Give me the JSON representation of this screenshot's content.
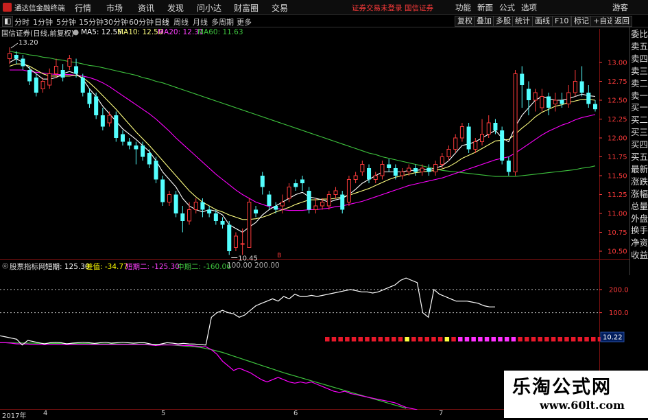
{
  "menubar": {
    "app_title": "通达信金融终端",
    "menus": [
      "行情",
      "市场",
      "资讯",
      "发现",
      "问小达",
      "财富圈",
      "交易"
    ],
    "login_warning": "证券交易未登录",
    "broker": "国信证券",
    "right_buttons": [
      "功能",
      "新面",
      "公式",
      "选项"
    ],
    "guest": "游客"
  },
  "periods": [
    "分时",
    "1分钟",
    "5分钟",
    "15分钟",
    "30分钟",
    "60分钟",
    "日线",
    "周线",
    "月线",
    "多周期",
    "更多"
  ],
  "active_period": "日线",
  "toolbar_right": [
    "复权",
    "叠加",
    "多股",
    "统计",
    "画线",
    "F10",
    "标记",
    "+自选",
    "返回"
  ],
  "info": {
    "title": "国信证券(日线,前复权)",
    "ma5": "MA5: 12.55",
    "ma10": "MA10: 12.50",
    "ma20": "MA20: 12.31",
    "ma60": "MA60: 11.63"
  },
  "colors": {
    "up": "#ff3b3b",
    "up_fill": "#000000",
    "down": "#54ffff",
    "ma5": "#ffffff",
    "ma10": "#ffff80",
    "ma20": "#ff00ff",
    "ma60": "#3ec43e",
    "grid": "#7a1010",
    "yellow": "#ffff00"
  },
  "right_panel": [
    "委比",
    "卖五",
    "卖四",
    "卖三",
    "卖二",
    "卖一",
    "买一",
    "买二",
    "买三",
    "买四",
    "买五",
    "最新",
    "涨跌",
    "涨幅",
    "总量",
    "外盘",
    "换手",
    "净资",
    "收益"
  ],
  "indicator": {
    "name": "股票指标网",
    "short_label": "短期: 125.30",
    "diff_label": "差值: -34.77",
    "short2_label": "短期二: -125.30",
    "mid2_label": "中期二: -160.06",
    "level100": "100.00",
    "level200": "200.00"
  },
  "dates": [
    "2017年",
    "4",
    "5",
    "6",
    "7"
  ],
  "watermark": {
    "cn": "乐淘公式网",
    "url": "www.60lt.com"
  },
  "chart_data": {
    "type": "candlestick",
    "price_axis": {
      "ticks": [
        13.0,
        12.75,
        12.5,
        12.25,
        12.0,
        11.75,
        11.5,
        11.25,
        11.0,
        10.75,
        10.5
      ],
      "ylim": [
        10.4,
        13.3
      ]
    },
    "annotations": {
      "high": "13.20",
      "low": "10.45",
      "marker": "B",
      "current_value": "10.22"
    },
    "candles": [
      {
        "o": 13.05,
        "c": 13.12,
        "h": 13.2,
        "l": 12.98
      },
      {
        "o": 13.1,
        "c": 13.05,
        "h": 13.15,
        "l": 12.98
      },
      {
        "o": 13.05,
        "c": 12.95,
        "h": 13.1,
        "l": 12.9
      },
      {
        "o": 12.9,
        "c": 12.75,
        "h": 12.95,
        "l": 12.7
      },
      {
        "o": 12.8,
        "c": 12.6,
        "h": 12.85,
        "l": 12.55
      },
      {
        "o": 12.65,
        "c": 12.75,
        "h": 12.8,
        "l": 12.6
      },
      {
        "o": 12.7,
        "c": 12.85,
        "h": 12.92,
        "l": 12.65
      },
      {
        "o": 12.85,
        "c": 12.95,
        "h": 13.05,
        "l": 12.8
      },
      {
        "o": 12.9,
        "c": 12.8,
        "h": 12.98,
        "l": 12.75
      },
      {
        "o": 12.95,
        "c": 13.05,
        "h": 13.1,
        "l": 12.9
      },
      {
        "o": 12.95,
        "c": 12.85,
        "h": 13.05,
        "l": 12.8
      },
      {
        "o": 12.8,
        "c": 12.6,
        "h": 12.85,
        "l": 12.55
      },
      {
        "o": 12.6,
        "c": 12.45,
        "h": 12.65,
        "l": 12.4
      },
      {
        "o": 12.55,
        "c": 12.3,
        "h": 12.6,
        "l": 12.25
      },
      {
        "o": 12.3,
        "c": 12.15,
        "h": 12.4,
        "l": 12.1
      },
      {
        "o": 12.2,
        "c": 12.3,
        "h": 12.35,
        "l": 12.15
      },
      {
        "o": 12.3,
        "c": 12.0,
        "h": 12.35,
        "l": 11.95
      },
      {
        "o": 12.05,
        "c": 11.95,
        "h": 12.1,
        "l": 11.9
      },
      {
        "o": 11.95,
        "c": 11.9,
        "h": 12.0,
        "l": 11.85
      },
      {
        "o": 11.9,
        "c": 11.85,
        "h": 11.95,
        "l": 11.65
      },
      {
        "o": 11.9,
        "c": 11.75,
        "h": 11.95,
        "l": 11.7
      },
      {
        "o": 11.8,
        "c": 11.65,
        "h": 11.85,
        "l": 11.6
      },
      {
        "o": 11.7,
        "c": 11.45,
        "h": 11.75,
        "l": 11.4
      },
      {
        "o": 11.45,
        "c": 11.15,
        "h": 11.5,
        "l": 11.1
      },
      {
        "o": 11.15,
        "c": 11.25,
        "h": 11.3,
        "l": 11.1
      },
      {
        "o": 11.25,
        "c": 11.0,
        "h": 11.3,
        "l": 10.95
      },
      {
        "o": 11.0,
        "c": 10.9,
        "h": 11.1,
        "l": 10.75
      },
      {
        "o": 10.9,
        "c": 11.05,
        "h": 11.15,
        "l": 10.85
      },
      {
        "o": 11.05,
        "c": 11.15,
        "h": 11.2,
        "l": 11.0
      },
      {
        "o": 11.15,
        "c": 11.05,
        "h": 11.2,
        "l": 10.95
      },
      {
        "o": 11.05,
        "c": 11.0,
        "h": 11.1,
        "l": 10.95
      },
      {
        "o": 11.0,
        "c": 10.9,
        "h": 11.05,
        "l": 10.85
      },
      {
        "o": 10.9,
        "c": 10.85,
        "h": 10.95,
        "l": 10.8
      },
      {
        "o": 10.85,
        "c": 10.5,
        "h": 10.9,
        "l": 10.45
      },
      {
        "o": 10.55,
        "c": 10.7,
        "h": 10.75,
        "l": 10.5
      },
      {
        "o": 10.6,
        "c": 10.6,
        "h": 10.8,
        "l": 10.45
      },
      {
        "o": 10.55,
        "c": 11.15,
        "h": 11.2,
        "l": 10.55
      },
      {
        "o": 11.05,
        "c": 11.0,
        "h": 11.1,
        "l": 10.95
      },
      {
        "o": 11.5,
        "c": 11.35,
        "h": 11.55,
        "l": 11.25
      },
      {
        "o": 11.25,
        "c": 11.1,
        "h": 11.3,
        "l": 11.05
      },
      {
        "o": 11.1,
        "c": 11.05,
        "h": 11.15,
        "l": 11.0
      },
      {
        "o": 11.1,
        "c": 11.15,
        "h": 11.25,
        "l": 11.0
      },
      {
        "o": 11.2,
        "c": 11.35,
        "h": 11.4,
        "l": 11.15
      },
      {
        "o": 11.4,
        "c": 11.35,
        "h": 11.45,
        "l": 11.3
      },
      {
        "o": 11.45,
        "c": 11.4,
        "h": 11.5,
        "l": 11.3
      },
      {
        "o": 11.3,
        "c": 11.05,
        "h": 11.35,
        "l": 11.0
      },
      {
        "o": 11.05,
        "c": 11.1,
        "h": 11.2,
        "l": 11.0
      },
      {
        "o": 11.1,
        "c": 11.15,
        "h": 11.2,
        "l": 11.05
      },
      {
        "o": 11.1,
        "c": 11.25,
        "h": 11.3,
        "l": 11.05
      },
      {
        "o": 11.25,
        "c": 11.3,
        "h": 11.35,
        "l": 11.2
      },
      {
        "o": 11.25,
        "c": 11.05,
        "h": 11.3,
        "l": 11.0
      },
      {
        "o": 11.15,
        "c": 11.45,
        "h": 11.5,
        "l": 11.1
      },
      {
        "o": 11.45,
        "c": 11.5,
        "h": 11.55,
        "l": 11.4
      },
      {
        "o": 11.55,
        "c": 11.65,
        "h": 11.7,
        "l": 11.5
      },
      {
        "o": 11.6,
        "c": 11.45,
        "h": 11.65,
        "l": 11.4
      },
      {
        "o": 11.45,
        "c": 11.5,
        "h": 11.55,
        "l": 11.4
      },
      {
        "o": 11.5,
        "c": 11.65,
        "h": 11.7,
        "l": 11.45
      },
      {
        "o": 11.65,
        "c": 11.6,
        "h": 11.72,
        "l": 11.55
      },
      {
        "o": 11.6,
        "c": 11.5,
        "h": 11.65,
        "l": 11.45
      },
      {
        "o": 11.5,
        "c": 11.55,
        "h": 11.6,
        "l": 11.45
      },
      {
        "o": 11.55,
        "c": 11.6,
        "h": 11.65,
        "l": 11.5
      },
      {
        "o": 11.6,
        "c": 11.55,
        "h": 11.65,
        "l": 11.5
      },
      {
        "o": 11.55,
        "c": 11.6,
        "h": 11.65,
        "l": 11.5
      },
      {
        "o": 11.6,
        "c": 11.55,
        "h": 11.65,
        "l": 11.5
      },
      {
        "o": 11.55,
        "c": 11.65,
        "h": 11.7,
        "l": 11.5
      },
      {
        "o": 11.65,
        "c": 11.75,
        "h": 11.8,
        "l": 11.6
      },
      {
        "o": 11.75,
        "c": 11.85,
        "h": 11.9,
        "l": 11.7
      },
      {
        "o": 11.85,
        "c": 12.0,
        "h": 12.05,
        "l": 11.8
      },
      {
        "o": 12.0,
        "c": 12.15,
        "h": 12.2,
        "l": 11.95
      },
      {
        "o": 12.15,
        "c": 11.85,
        "h": 12.2,
        "l": 11.8
      },
      {
        "o": 11.85,
        "c": 11.95,
        "h": 12.0,
        "l": 11.8
      },
      {
        "o": 11.95,
        "c": 12.05,
        "h": 12.25,
        "l": 11.9
      },
      {
        "o": 12.05,
        "c": 12.2,
        "h": 12.3,
        "l": 12.0
      },
      {
        "o": 12.2,
        "c": 12.1,
        "h": 12.25,
        "l": 12.05
      },
      {
        "o": 12.1,
        "c": 11.7,
        "h": 12.15,
        "l": 11.65
      },
      {
        "o": 11.7,
        "c": 11.55,
        "h": 11.75,
        "l": 11.5
      },
      {
        "o": 11.55,
        "c": 12.85,
        "h": 12.9,
        "l": 11.5
      },
      {
        "o": 12.85,
        "c": 12.7,
        "h": 12.95,
        "l": 12.4
      },
      {
        "o": 12.65,
        "c": 12.5,
        "h": 12.75,
        "l": 12.3
      },
      {
        "o": 12.5,
        "c": 12.6,
        "h": 12.65,
        "l": 12.35
      },
      {
        "o": 12.4,
        "c": 12.55,
        "h": 12.65,
        "l": 12.35
      },
      {
        "o": 12.55,
        "c": 12.4,
        "h": 12.6,
        "l": 12.3
      },
      {
        "o": 12.45,
        "c": 12.5,
        "h": 12.6,
        "l": 12.35
      },
      {
        "o": 12.5,
        "c": 12.45,
        "h": 12.6,
        "l": 12.4
      },
      {
        "o": 12.45,
        "c": 12.6,
        "h": 12.7,
        "l": 12.4
      },
      {
        "o": 12.6,
        "c": 12.75,
        "h": 12.9,
        "l": 12.55
      },
      {
        "o": 12.75,
        "c": 12.6,
        "h": 12.95,
        "l": 12.55
      },
      {
        "o": 12.6,
        "c": 12.45,
        "h": 12.7,
        "l": 12.4
      },
      {
        "o": 12.45,
        "c": 12.38,
        "h": 12.5,
        "l": 12.35
      }
    ],
    "ma5": [
      13.0,
      13.05,
      13.0,
      12.92,
      12.85,
      12.78,
      12.78,
      12.8,
      12.85,
      12.88,
      12.85,
      12.78,
      12.65,
      12.55,
      12.42,
      12.32,
      12.22,
      12.12,
      12.05,
      11.98,
      11.9,
      11.82,
      11.7,
      11.55,
      11.45,
      11.35,
      11.2,
      11.1,
      11.05,
      11.02,
      11.05,
      11.03,
      10.98,
      10.85,
      10.8,
      10.75,
      10.82,
      10.88,
      10.98,
      11.05,
      11.1,
      11.15,
      11.2,
      11.25,
      11.28,
      11.22,
      11.2,
      11.18,
      11.15,
      11.18,
      11.2,
      11.25,
      11.32,
      11.4,
      11.45,
      11.5,
      11.55,
      11.55,
      11.55,
      11.55,
      11.57,
      11.57,
      11.58,
      11.58,
      11.6,
      11.63,
      11.7,
      11.8,
      11.9,
      11.92,
      11.95,
      12.0,
      12.05,
      12.1,
      12.0,
      11.95,
      12.15,
      12.3,
      12.4,
      12.5,
      12.55,
      12.52,
      12.5,
      12.5,
      12.52,
      12.55,
      12.58,
      12.56,
      12.55
    ],
    "ma10": [
      12.95,
      12.98,
      12.98,
      12.95,
      12.9,
      12.85,
      12.82,
      12.82,
      12.82,
      12.82,
      12.83,
      12.8,
      12.73,
      12.65,
      12.56,
      12.47,
      12.38,
      12.28,
      12.18,
      12.08,
      11.99,
      11.9,
      11.8,
      11.7,
      11.6,
      11.5,
      11.4,
      11.3,
      11.22,
      11.15,
      11.1,
      11.05,
      11.02,
      10.98,
      10.95,
      10.92,
      10.92,
      10.93,
      10.95,
      10.98,
      11.02,
      11.05,
      11.08,
      11.12,
      11.15,
      11.18,
      11.18,
      11.19,
      11.19,
      11.2,
      11.22,
      11.24,
      11.27,
      11.3,
      11.33,
      11.37,
      11.41,
      11.45,
      11.48,
      11.5,
      11.52,
      11.54,
      11.55,
      11.56,
      11.57,
      11.59,
      11.62,
      11.67,
      11.73,
      11.77,
      11.81,
      11.86,
      11.91,
      11.96,
      11.97,
      11.98,
      12.05,
      12.13,
      12.2,
      12.28,
      12.34,
      12.38,
      12.42,
      12.44,
      12.47,
      12.49,
      12.51,
      12.51,
      12.5
    ],
    "ma20": [
      12.9,
      12.9,
      12.9,
      12.88,
      12.87,
      12.86,
      12.85,
      12.84,
      12.84,
      12.84,
      12.83,
      12.82,
      12.8,
      12.77,
      12.73,
      12.68,
      12.62,
      12.56,
      12.5,
      12.44,
      12.38,
      12.32,
      12.25,
      12.17,
      12.09,
      12.0,
      11.92,
      11.84,
      11.76,
      11.68,
      11.6,
      11.52,
      11.45,
      11.38,
      11.31,
      11.25,
      11.2,
      11.15,
      11.12,
      11.09,
      11.07,
      11.05,
      11.04,
      11.04,
      11.04,
      11.05,
      11.05,
      11.06,
      11.07,
      11.09,
      11.1,
      11.12,
      11.14,
      11.16,
      11.19,
      11.22,
      11.25,
      11.28,
      11.31,
      11.34,
      11.37,
      11.39,
      11.41,
      11.43,
      11.45,
      11.47,
      11.5,
      11.53,
      11.56,
      11.59,
      11.62,
      11.65,
      11.68,
      11.71,
      11.73,
      11.75,
      11.8,
      11.86,
      11.92,
      11.98,
      12.04,
      12.09,
      12.13,
      12.17,
      12.2,
      12.24,
      12.27,
      12.29,
      12.31
    ],
    "ma60": [
      13.15,
      13.13,
      13.12,
      13.1,
      13.09,
      13.07,
      13.06,
      13.04,
      13.03,
      13.01,
      13.0,
      12.98,
      12.96,
      12.95,
      12.93,
      12.91,
      12.89,
      12.87,
      12.85,
      12.83,
      12.8,
      12.78,
      12.75,
      12.73,
      12.7,
      12.67,
      12.64,
      12.61,
      12.58,
      12.55,
      12.52,
      12.49,
      12.46,
      12.43,
      12.4,
      12.37,
      12.34,
      12.31,
      12.28,
      12.25,
      12.22,
      12.19,
      12.16,
      12.13,
      12.1,
      12.07,
      12.04,
      12.01,
      11.98,
      11.95,
      11.92,
      11.89,
      11.86,
      11.83,
      11.8,
      11.78,
      11.75,
      11.73,
      11.71,
      11.69,
      11.67,
      11.65,
      11.63,
      11.61,
      11.59,
      11.57,
      11.56,
      11.55,
      11.54,
      11.53,
      11.52,
      11.51,
      11.5,
      11.49,
      11.49,
      11.49,
      11.49,
      11.5,
      11.51,
      11.52,
      11.53,
      11.54,
      11.55,
      11.56,
      11.57,
      11.58,
      11.6,
      11.61,
      11.63
    ],
    "indicator": {
      "ylim": [
        -320,
        280
      ],
      "levels": [
        200,
        100
      ],
      "short": [
        0,
        -5,
        -10,
        -15,
        -40,
        -20,
        -25,
        -30,
        -35,
        -30,
        -28,
        -30,
        -35,
        -32,
        -30,
        -28,
        -30,
        -33,
        -30,
        -28,
        -32,
        -30,
        -28,
        -30,
        -32,
        -30,
        -30,
        -35,
        -40,
        -35,
        -30,
        -32,
        -35,
        -33,
        -35,
        -36,
        -38,
        -40,
        80,
        100,
        110,
        100,
        95,
        80,
        90,
        110,
        130,
        140,
        150,
        160,
        150,
        170,
        160,
        180,
        170,
        170,
        175,
        170,
        175,
        180,
        185,
        190,
        195,
        200,
        195,
        190,
        190,
        185,
        190,
        200,
        210,
        220,
        240,
        250,
        240,
        230,
        100,
        80,
        200,
        180,
        170,
        160,
        150,
        150,
        150,
        145,
        140,
        130,
        125,
        125
      ],
      "short2": [
        -30,
        -30,
        -32,
        -35,
        -35,
        -36,
        -38,
        -38,
        -38,
        -38,
        -38,
        -38,
        -38,
        -38,
        -38,
        -38,
        -38,
        -38,
        -38,
        -38,
        -38,
        -38,
        -38,
        -38,
        -38,
        -38,
        -38,
        -40,
        -42,
        -40,
        -40,
        -40,
        -40,
        -42,
        -42,
        -44,
        -46,
        -48,
        -60,
        -80,
        -110,
        -130,
        -150,
        -140,
        -150,
        -160,
        -175,
        -190,
        -200,
        -190,
        -180,
        -190,
        -200,
        -205,
        -200,
        -205,
        -200,
        -210,
        -220,
        -230,
        -240,
        -245,
        -240,
        -250,
        -255,
        -260,
        -265,
        -270,
        -275,
        -280,
        -285,
        -290,
        -300,
        -310,
        -315,
        -320,
        -330,
        -335,
        -340,
        -345,
        -350,
        -355,
        -360,
        -365,
        -370,
        -375,
        -380,
        -385,
        -390
      ],
      "mid2": [
        -30,
        -30,
        -30,
        -31,
        -31,
        -32,
        -32,
        -33,
        -33,
        -33,
        -33,
        -33,
        -34,
        -34,
        -34,
        -34,
        -34,
        -35,
        -35,
        -35,
        -35,
        -35,
        -36,
        -36,
        -36,
        -36,
        -36,
        -37,
        -37,
        -38,
        -38,
        -40,
        -42,
        -44,
        -46,
        -48,
        -50,
        -55,
        -60,
        -66,
        -72,
        -80,
        -88,
        -96,
        -104,
        -112,
        -120,
        -128,
        -136,
        -144,
        -152,
        -160,
        -167,
        -174,
        -181,
        -188,
        -195,
        -202,
        -209,
        -216,
        -223,
        -230,
        -237,
        -244,
        -251,
        -258,
        -265,
        -272,
        -279,
        -286,
        -293,
        -300,
        -307,
        -314,
        -321,
        -328,
        -335,
        -342,
        -349,
        -356,
        -363,
        -370,
        -377,
        -384,
        -391,
        -398,
        -405,
        -412,
        -419
      ],
      "squares": [
        "r",
        "r",
        "r",
        "r",
        "r",
        "r",
        "r",
        "r",
        "r",
        "r",
        "r",
        "r",
        "y",
        "r",
        "r",
        "r",
        "r",
        "r",
        "y",
        "r",
        "m",
        "m",
        "m",
        "m",
        "m",
        "m",
        "m",
        "m",
        "m",
        "r",
        "r",
        "r",
        "r",
        "r",
        "r",
        "r",
        "r",
        "r",
        "r",
        "r",
        "r",
        "r"
      ]
    }
  }
}
